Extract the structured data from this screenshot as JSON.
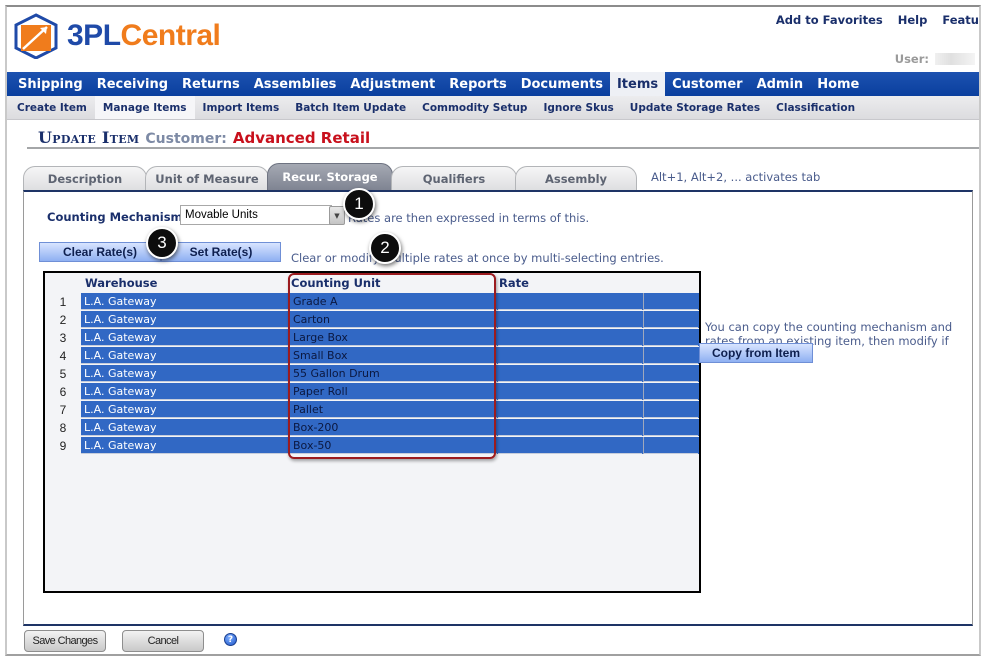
{
  "header": {
    "logo": {
      "part1": "3PL",
      "part2": "Central"
    },
    "top_links": [
      "Add to Favorites",
      "Help",
      "Featu"
    ],
    "user_label": "User:"
  },
  "nav": {
    "items": [
      "Shipping",
      "Receiving",
      "Returns",
      "Assemblies",
      "Adjustment",
      "Reports",
      "Documents",
      "Items",
      "Customer",
      "Admin",
      "Home"
    ],
    "active": "Items"
  },
  "subnav": {
    "items": [
      "Create Item",
      "Manage Items",
      "Import Items",
      "Batch Item Update",
      "Commodity Setup",
      "Ignore Skus",
      "Update Storage Rates",
      "Classification"
    ],
    "active": "Manage Items"
  },
  "page": {
    "title": "Update Item",
    "customer_label": "Customer:",
    "customer_name": "Advanced Retail"
  },
  "tabs": {
    "items": [
      "Description",
      "Unit of Measure",
      "Recur. Storage",
      "Qualifiers",
      "Assembly"
    ],
    "active": "Recur. Storage",
    "hint": "Alt+1, Alt+2, ... activates tab"
  },
  "counting_mechanism": {
    "label": "Counting Mechanism",
    "value": "Movable Units",
    "hint": "Rates are then expressed in terms of this."
  },
  "rate_buttons": {
    "clear": "Clear Rate(s)",
    "set": "Set Rate(s)",
    "hint": "Clear or modify multiple rates at once by multi-selecting entries."
  },
  "grid": {
    "columns": [
      "Warehouse",
      "Counting Unit",
      "Rate"
    ],
    "rows": [
      {
        "num": "1",
        "warehouse": "L.A. Gateway",
        "unit": "Grade A",
        "rate": ""
      },
      {
        "num": "2",
        "warehouse": "L.A. Gateway",
        "unit": "Carton",
        "rate": ""
      },
      {
        "num": "3",
        "warehouse": "L.A. Gateway",
        "unit": "Large Box",
        "rate": ""
      },
      {
        "num": "4",
        "warehouse": "L.A. Gateway",
        "unit": "Small Box",
        "rate": ""
      },
      {
        "num": "5",
        "warehouse": "L.A. Gateway",
        "unit": "55 Gallon Drum",
        "rate": ""
      },
      {
        "num": "6",
        "warehouse": "L.A. Gateway",
        "unit": "Paper Roll",
        "rate": ""
      },
      {
        "num": "7",
        "warehouse": "L.A. Gateway",
        "unit": "Pallet",
        "rate": ""
      },
      {
        "num": "8",
        "warehouse": "L.A. Gateway",
        "unit": "Box-200",
        "rate": ""
      },
      {
        "num": "9",
        "warehouse": "L.A. Gateway",
        "unit": "Box-50",
        "rate": ""
      }
    ],
    "selection_color": "#3168c4"
  },
  "copy": {
    "hint": "You can copy the counting mechanism and rates from an existing item, then modify if necessary.",
    "button": "Copy from Item"
  },
  "footer": {
    "save": "Save Changes",
    "cancel": "Cancel"
  },
  "callouts": [
    "1",
    "2",
    "3"
  ],
  "colors": {
    "brand_blue": "#1f4aa8",
    "brand_orange": "#f07c1c",
    "nav_blue": "#0a3f9e",
    "customer_red": "#c8101c",
    "highlight_red": "#9b1b1f"
  }
}
